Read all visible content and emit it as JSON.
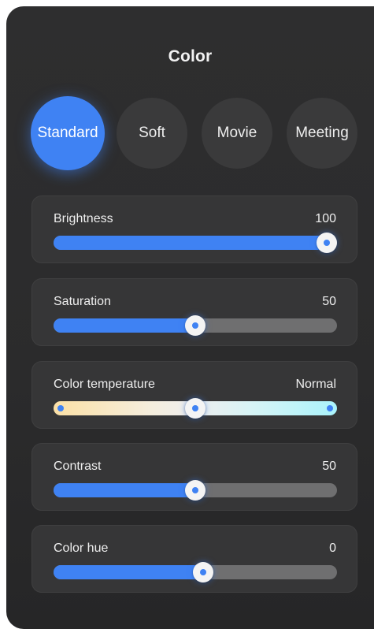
{
  "panel": {
    "title": "Color"
  },
  "presets": [
    {
      "label": "Standard",
      "active": true
    },
    {
      "label": "Soft",
      "active": false
    },
    {
      "label": "Movie",
      "active": false
    },
    {
      "label": "Meeting",
      "active": false
    }
  ],
  "settings": {
    "brightness": {
      "label": "Brightness",
      "value": "100",
      "level": 1.0
    },
    "saturation": {
      "label": "Saturation",
      "value": "50",
      "level": 0.5
    },
    "color_temperature": {
      "label": "Color temperature",
      "value": "Normal",
      "level": 0.5
    },
    "contrast": {
      "label": "Contrast",
      "value": "50",
      "level": 0.5
    },
    "color_hue": {
      "label": "Color hue",
      "value": "0",
      "level": 0.53
    }
  },
  "colors": {
    "accent": "#3f82f3",
    "panel_background": "#2e2e2f",
    "card_background": "#363637",
    "track_inactive": "#6f6f70",
    "temperature_warm": "#fbe0a6",
    "temperature_cool": "#aaf3fb"
  },
  "icons": {
    "slider_thumb": "slider-thumb-icon"
  }
}
